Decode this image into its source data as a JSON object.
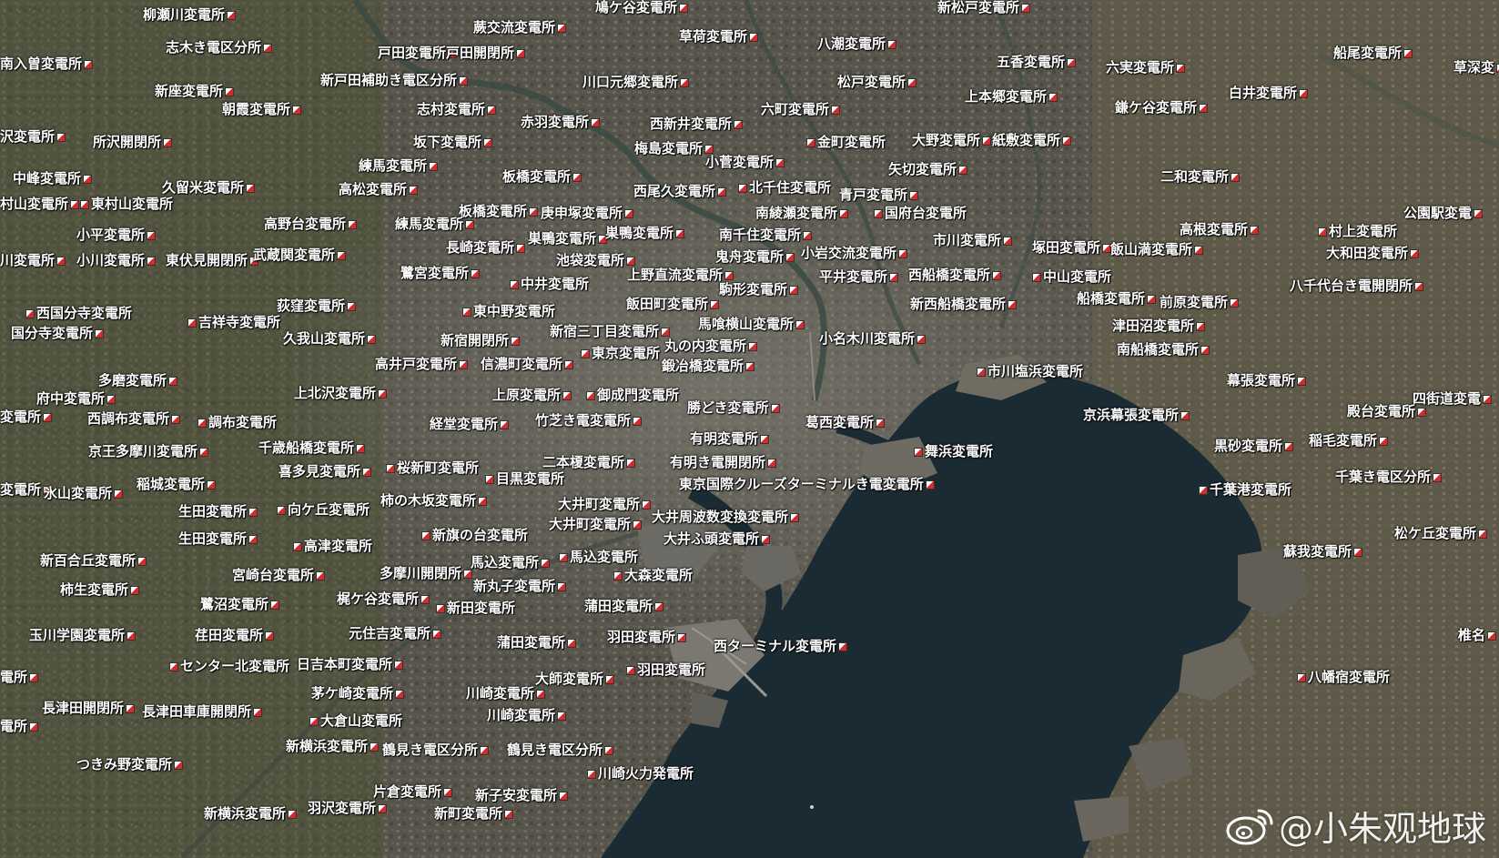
{
  "map": {
    "water_color": "#1a2a33",
    "urban_color": "#56544a",
    "vegetation_color": "#44502f",
    "pin_colors": [
      "#ffffff",
      "#d72a2a"
    ]
  },
  "labels": [
    "柳瀬川変電所",
    "蕨交流変電所",
    "鳩ケ谷変電所",
    "新松戸変電所",
    "志木き電区分所",
    "戸田変電所",
    "戸田開閉所",
    "草荷変電所",
    "八潮変電所",
    "船尾変電所",
    "草深変",
    "南入曽変電所",
    "五香変電所",
    "六実変電所",
    "新戸田補助き電区分所",
    "川口元郷変電所",
    "松戸変電所",
    "新座変電所",
    "白井変電所",
    "上本郷変電所",
    "朝霞変電所",
    "志村変電所",
    "六町変電所",
    "鎌ケ谷変電所",
    "赤羽変電所",
    "西新井変電所",
    "沢変電所",
    "所沢開閉所",
    "坂下変電所",
    "金町変電所",
    "大野変電所",
    "紙敷変電所",
    "梅島変電所",
    "練馬変電所",
    "小菅変電所",
    "矢切変電所",
    "中峰変電所",
    "板橋変電所",
    "二和変電所",
    "久留米変電所",
    "北千住変電所",
    "高松変電所",
    "西尾久変電所",
    "青戸変電所",
    "村山変電所",
    "東村山変電所",
    "板橋変電所",
    "庚申塚変電所",
    "南綾瀬変電所",
    "国府台変電所",
    "公園駅変電",
    "高野台変電所",
    "練馬変電所",
    "南千住変電所",
    "高根変電所",
    "村上変電所",
    "小平変電所",
    "巣鴨変電所",
    "巣鴨変電所",
    "市川変電所",
    "長崎変電所",
    "鬼舟変電所",
    "小岩交流変電所",
    "塚田変電所",
    "飯山満変電所",
    "大和田変電所",
    "川変電所",
    "小川変電所",
    "東伏見開閉所",
    "武蔵関変電所",
    "池袋変電所",
    "鷺宮変電所",
    "上野直流変電所",
    "中山変電所",
    "平井変電所",
    "西船橋変電所",
    "八千代台き電開閉所",
    "中井変電所",
    "駒形変電所",
    "西国分寺変電所",
    "荻窪変電所",
    "飯田町変電所",
    "船橋変電所",
    "前原変電所",
    "新西船橋変電所",
    "東中野変電所",
    "吉祥寺変電所",
    "馬喰横山変電所",
    "国分寺変電所",
    "新宿三丁目変電所",
    "津田沼変電所",
    "小名木川変電所",
    "久我山変電所",
    "新宿開閉所",
    "丸の内変電所",
    "南船橋変電所",
    "東京変電所",
    "高井戸変電所",
    "信濃町変電所",
    "鍛冶橋変電所",
    "市川塩浜変電所",
    "多磨変電所",
    "幕張変電所",
    "府中変電所",
    "上北沢変電所",
    "上原変電所",
    "御成門変電所",
    "四街道変電",
    "殿台変電所",
    "勝どき変電所",
    "変電所",
    "西調布変電所",
    "調布変電所",
    "京浜幕張変電所",
    "経堂変電所",
    "竹芝き電変電所",
    "葛西変電所",
    "有明変電所",
    "稲毛変電所",
    "京王多摩川変電所",
    "千歳船橋変電所",
    "黒砂変電所",
    "舞浜変電所",
    "有明き電開閉所",
    "二本榎変電所",
    "喜多見変電所",
    "桜新町変電所",
    "千葉き電区分所",
    "目黒変電所",
    "東京国際クルーズターミナルき電変電所",
    "変電所",
    "氷山変電所",
    "稲城変電所",
    "千葉港変電所",
    "大井町変電所",
    "柿の木坂変電所",
    "生田変電所",
    "向ケ丘変電所",
    "大井周波数変換変電所",
    "大井町変電所",
    "新旗の台変電所",
    "大井ふ頭変電所",
    "生田変電所",
    "高津変電所",
    "松ケ丘変電所",
    "馬込変電所",
    "新百合丘変電所",
    "馬込変電所",
    "蘇我変電所",
    "多摩川開閉所",
    "宮崎台変電所",
    "大森変電所",
    "新丸子変電所",
    "柿生変電所",
    "梶ケ谷変電所",
    "新田変電所",
    "鷺沼変電所",
    "蒲田変電所",
    "玉川学園変電所",
    "荏田変電所",
    "元住吉変電所",
    "羽田変電所",
    "蒲田変電所",
    "西ターミナル変電所",
    "椎名",
    "センター北変電所",
    "日吉本町変電所",
    "羽田変電所",
    "八幡宿変電所",
    "電所",
    "茅ケ崎変電所",
    "大師変電所",
    "長津田開閉所",
    "長津田車庫開閉所",
    "川崎変電所",
    "川崎変電所",
    "大倉山変電所",
    "電所",
    "新横浜変電所",
    "鶴見き電区分所",
    "鶴見き電区分所",
    "つきみ野変電所",
    "川崎火力発電所",
    "片倉変電所",
    "新子安変電所",
    "羽沢変電所",
    "新横浜変電所",
    "新町変電所"
  ],
  "watermark": {
    "text": "@小朱观地球",
    "icon": "weibo-logo-icon"
  }
}
